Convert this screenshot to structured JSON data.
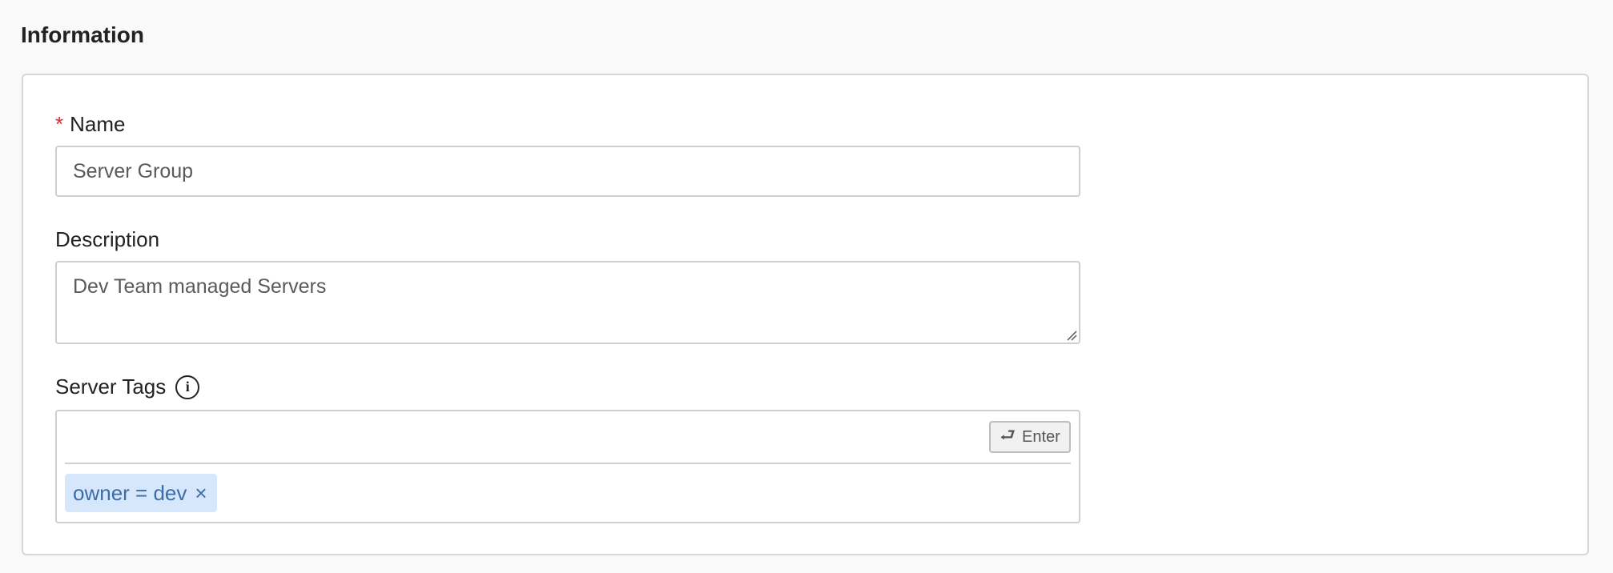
{
  "section": {
    "title": "Information"
  },
  "form": {
    "name": {
      "label": "Name",
      "required_mark": "*",
      "value": "Server Group"
    },
    "description": {
      "label": "Description",
      "value": "Dev Team managed Servers"
    },
    "server_tags": {
      "label": "Server Tags",
      "info_icon": "info-icon",
      "input_value": "",
      "enter_button": {
        "icon": "return-arrow-icon",
        "label": "Enter"
      },
      "tags": [
        {
          "label": "owner = dev",
          "remove_icon": "close-icon"
        }
      ]
    }
  },
  "colors": {
    "required": "#d32f2f",
    "tag_background": "#d6e7fb",
    "tag_text": "#3b6ea8"
  }
}
